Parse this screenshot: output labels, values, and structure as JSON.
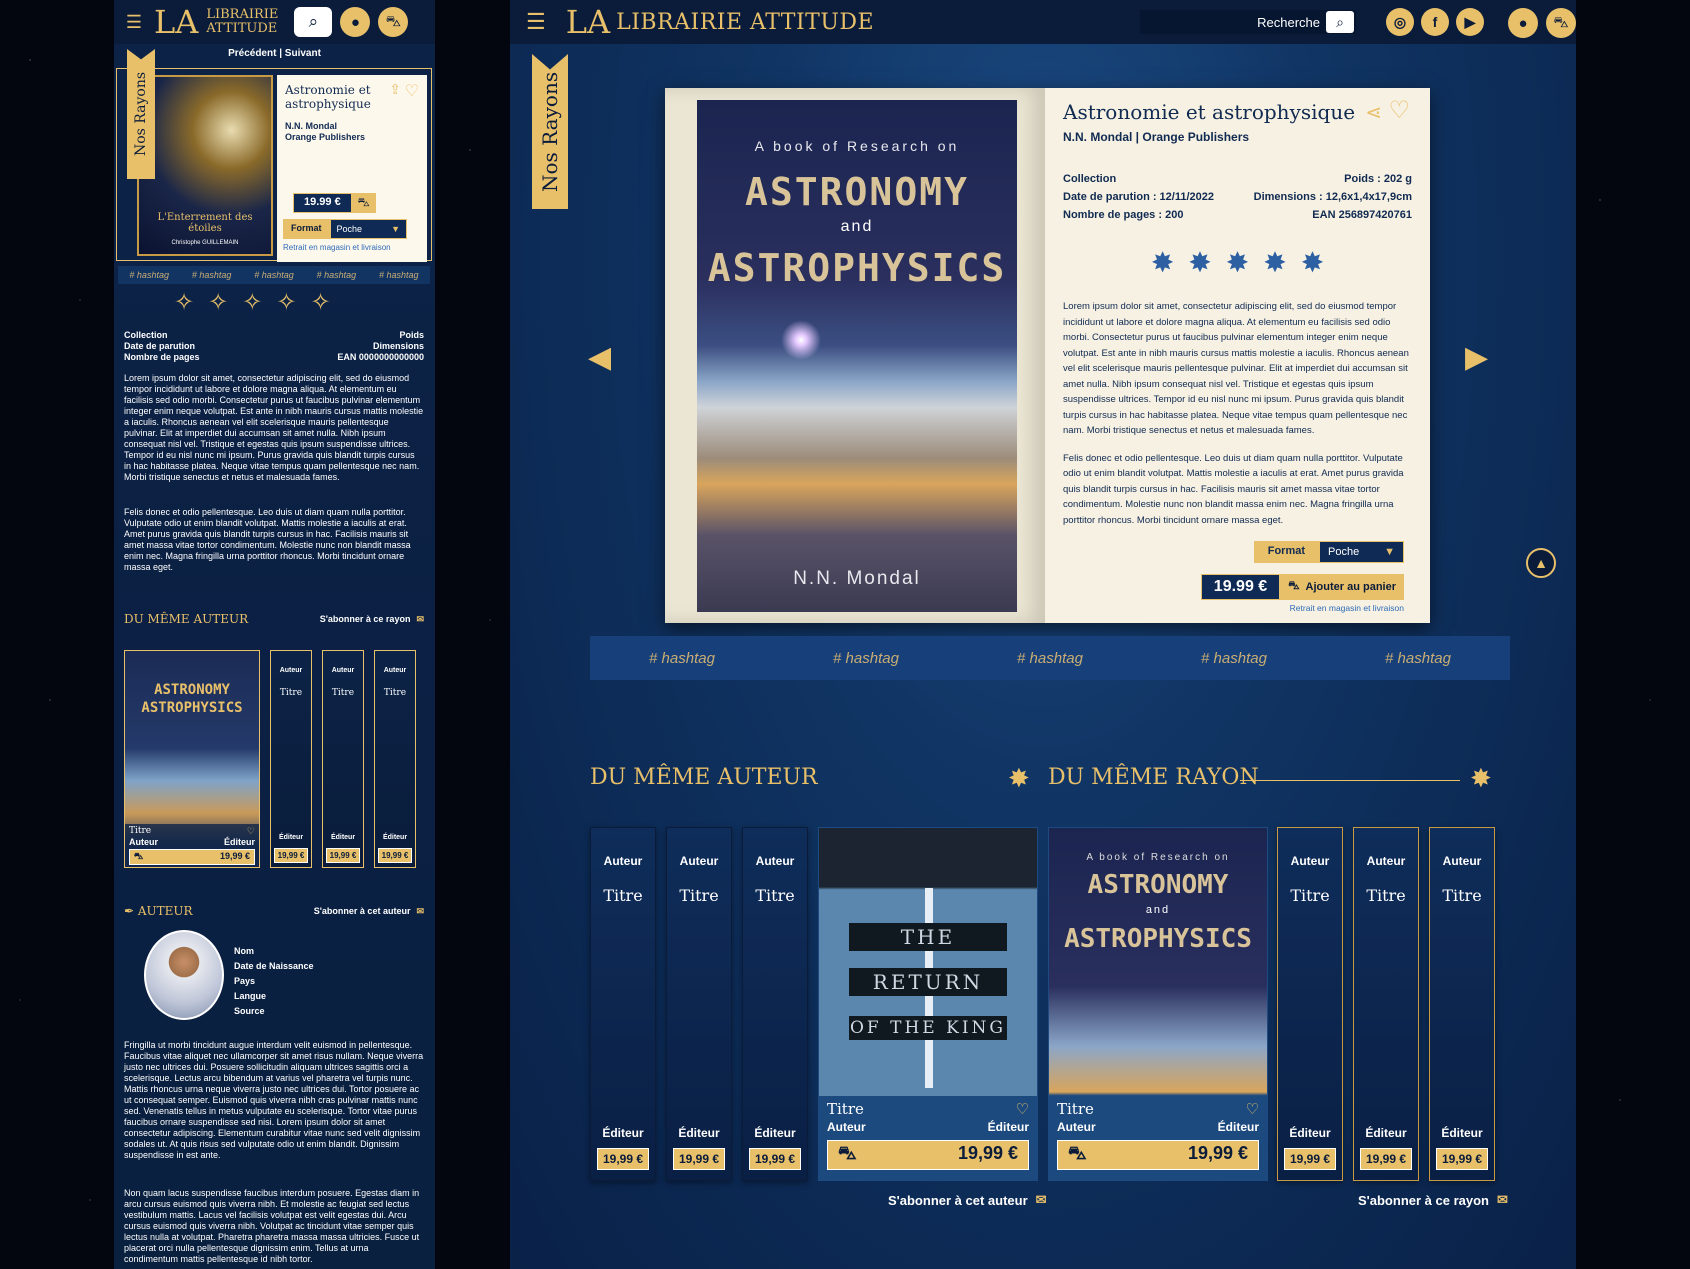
{
  "brand": {
    "name": "LIBRAIRIE ATTITUDE",
    "name_line1": "LIBRAIRIE",
    "name_line2": "ATTITUDE",
    "mark": "LA"
  },
  "nav": {
    "prev": "Précédent",
    "next": "Suivant",
    "ribbon": "Nos Rayons",
    "search_placeholder": "Recherche"
  },
  "mobile": {
    "book": {
      "title": "Astronomie et astrophysique",
      "author": "N.N. Mondal",
      "publisher": "Orange Publishers",
      "price": "19.99 €",
      "format_label": "Format",
      "format_value": "Poche",
      "retrait": "Retrait en magasin et livraison",
      "cover_title": "L'Enterrement des étoiles",
      "cover_author": "Christophe GUILLEMAIN"
    },
    "hashtags": [
      "# hashtag",
      "# hashtag",
      "# hashtag",
      "# hashtag",
      "# hashtag"
    ],
    "meta": {
      "collection": "Collection",
      "poids": "Poids",
      "date": "Date de parution",
      "dimensions": "Dimensions",
      "pages": "Nombre de pages",
      "ean": "EAN 0000000000000"
    },
    "text1": "Lorem ipsum dolor sit amet, consectetur adipiscing elit, sed do eiusmod tempor incididunt ut labore et dolore magna aliqua. At elementum eu facilisis sed odio morbi. Consectetur purus ut faucibus pulvinar elementum integer enim neque volutpat. Est ante in nibh mauris cursus mattis molestie a iaculis. Rhoncus aenean vel elit scelerisque mauris pellentesque pulvinar. Elit at imperdiet dui accumsan sit amet nulla. Nibh ipsum consequat nisl vel. Tristique et egestas quis ipsum suspendisse ultrices. Tempor id eu nisl nunc mi ipsum. Purus gravida quis blandit turpis cursus in hac habitasse platea. Neque vitae tempus quam pellentesque nec nam. Morbi tristique senectus et netus et malesuada fames.",
    "text2": "Felis donec et odio pellentesque. Leo duis ut diam quam nulla porttitor. Vulputate odio ut enim blandit volutpat. Mattis molestie a iaculis at erat. Amet purus gravida quis blandit turpis cursus in hac. Facilisis mauris sit amet massa vitae tortor condimentum. Molestie nunc non blandit massa enim nec. Magna fringilla urna porttitor rhoncus. Morbi tincidunt ornare massa eget.",
    "same_author": "DU MÊME AUTEUR",
    "subscribe_rayon": "S'abonner à ce rayon",
    "books": {
      "big_title": "Titre",
      "big_author": "Auteur",
      "big_editor": "Éditeur",
      "big_price": "19,99 €",
      "slim": [
        {
          "a": "Auteur",
          "t": "Titre",
          "e": "Éditeur",
          "p": "19,99 €"
        },
        {
          "a": "Auteur",
          "t": "Titre",
          "e": "Éditeur",
          "p": "19,99 €"
        },
        {
          "a": "Auteur",
          "t": "Titre",
          "e": "Éditeur",
          "p": "19,99 €"
        }
      ]
    },
    "author_section": "AUTEUR",
    "subscribe_author": "S'abonner à cet auteur",
    "author_fields": [
      "Nom",
      "Date de Naissance",
      "Pays",
      "Langue",
      "Source"
    ],
    "author_text1": "Fringilla ut morbi tincidunt augue interdum velit euismod in pellentesque. Faucibus vitae aliquet nec ullamcorper sit amet risus nullam. Neque viverra justo nec ultrices dui. Posuere sollicitudin aliquam ultrices sagittis orci a scelerisque. Lectus arcu bibendum at varius vel pharetra vel turpis nunc. Mattis rhoncus urna neque viverra justo nec ultrices dui. Tortor posuere ac ut consequat semper. Euismod quis viverra nibh cras pulvinar mattis nunc sed. Venenatis tellus in metus vulputate eu scelerisque. Tortor vitae purus faucibus ornare suspendisse sed nisi. Lorem ipsum dolor sit amet consectetur adipiscing. Elementum curabitur vitae nunc sed velit dignissim sodales ut. At quis risus sed vulputate odio ut enim blandit. Dignissim suspendisse in est ante.",
    "author_text2": "Non quam lacus suspendisse faucibus interdum posuere. Egestas diam in arcu cursus euismod quis viverra nibh. Et molestie ac feugiat sed lectus vestibulum mattis. Lacus vel facilisis volutpat est velit egestas dui. Arcu cursus euismod quis viverra nibh. Volutpat ac tincidunt vitae semper quis lectus nulla at volutpat. Pharetra pharetra massa massa ultricies. Fusce ut placerat orci nulla pellentesque dignissim enim. Tellus at urna condimentum mattis pellentesque id nibh tortor."
  },
  "desktop": {
    "book": {
      "title": "Astronomie et astrophysique",
      "byline": "N.N. Mondal | Orange Publishers",
      "collection": "Collection",
      "poids": "Poids : 202 g",
      "date": "Date de parution : 12/11/2022",
      "dimensions": "Dimensions : 12,6x1,4x17,9cm",
      "pages": "Nombre de pages : 200",
      "ean": "EAN 256897420761",
      "text1": "Lorem ipsum dolor sit amet, consectetur adipiscing elit, sed do eiusmod tempor incididunt ut labore et dolore magna aliqua. At elementum eu facilisis sed odio morbi. Consectetur purus ut faucibus pulvinar elementum integer enim neque volutpat. Est ante in nibh mauris cursus mattis molestie a iaculis. Rhoncus aenean vel elit scelerisque mauris pellentesque pulvinar. Elit at imperdiet dui accumsan sit amet nulla. Nibh ipsum consequat nisl vel. Tristique et egestas quis ipsum suspendisse ultrices. Tempor id eu nisl nunc mi ipsum. Purus gravida quis blandit turpis cursus in hac habitasse platea. Neque vitae tempus quam pellentesque nec nam. Morbi tristique senectus et netus et malesuada fames.",
      "text2": "Felis donec et odio pellentesque. Leo duis ut diam quam nulla porttitor. Vulputate odio ut enim blandit volutpat. Mattis molestie a iaculis at erat. Amet purus gravida quis blandit turpis cursus in hac. Facilisis mauris sit amet massa vitae tortor condimentum. Molestie nunc non blandit massa enim nec. Magna fringilla urna porttitor rhoncus. Morbi tincidunt ornare massa eget.",
      "format_label": "Format",
      "format_value": "Poche",
      "price": "19.99 €",
      "add_to_cart": "Ajouter au panier",
      "retrait": "Retrait en magasin et livraison",
      "cover_sub": "A book of Research on",
      "cover_t1": "ASTRONOMY",
      "cover_t2": "and",
      "cover_t3": "ASTROPHYSICS",
      "cover_author": "N.N. Mondal"
    },
    "hashtags": [
      "# hashtag",
      "# hashtag",
      "# hashtag",
      "# hashtag",
      "# hashtag"
    ],
    "same_author": "DU MÊME AUTEUR",
    "same_rayon": "DU MÊME RAYON",
    "columns_left": [
      {
        "a": "Auteur",
        "t": "Titre",
        "e": "Éditeur",
        "p": "19,99 €"
      },
      {
        "a": "Auteur",
        "t": "Titre",
        "e": "Éditeur",
        "p": "19,99 €"
      },
      {
        "a": "Auteur",
        "t": "Titre",
        "e": "Éditeur",
        "p": "19,99 €"
      }
    ],
    "feat1": {
      "tt1": "THE",
      "tt2": "RETURN",
      "tt3": "OF THE KING",
      "title": "Titre",
      "author": "Auteur",
      "editor": "Éditeur",
      "price": "19,99 €"
    },
    "feat2": {
      "title": "Titre",
      "author": "Auteur",
      "editor": "Éditeur",
      "price": "19,99 €"
    },
    "columns_right": [
      {
        "a": "Auteur",
        "t": "Titre",
        "e": "Éditeur",
        "p": "19,99 €"
      },
      {
        "a": "Auteur",
        "t": "Titre",
        "e": "Éditeur",
        "p": "19,99 €"
      },
      {
        "a": "Auteur",
        "t": "Titre",
        "e": "Éditeur",
        "p": "19,99 €"
      }
    ],
    "subscribe_author": "S'abonner à cet auteur",
    "subscribe_rayon": "S'abonner à ce rayon"
  },
  "colors": {
    "gold": "#e9c06a",
    "navy": "#0a1c3a",
    "blue": "#103463"
  }
}
